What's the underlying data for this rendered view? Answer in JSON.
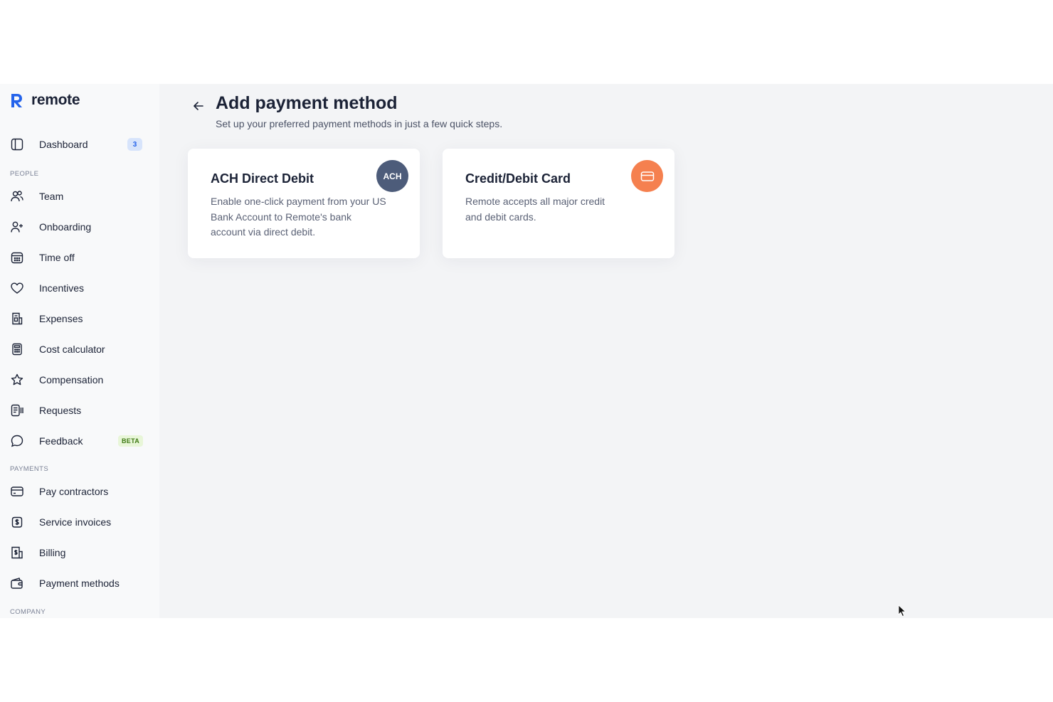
{
  "brand": {
    "name": "remote",
    "accent": "#2463eb"
  },
  "sidebar": {
    "dashboard": {
      "label": "Dashboard",
      "badge": "3",
      "icon": "sidebar-panel-icon"
    },
    "people_section": "PEOPLE",
    "people_items": [
      {
        "label": "Team",
        "icon": "team-icon"
      },
      {
        "label": "Onboarding",
        "icon": "user-plus-icon"
      },
      {
        "label": "Time off",
        "icon": "calendar-icon"
      },
      {
        "label": "Incentives",
        "icon": "heart-icon"
      },
      {
        "label": "Expenses",
        "icon": "receipt-icon"
      },
      {
        "label": "Cost calculator",
        "icon": "calculator-icon"
      },
      {
        "label": "Compensation",
        "icon": "star-icon"
      },
      {
        "label": "Requests",
        "icon": "requests-icon"
      },
      {
        "label": "Feedback",
        "icon": "chat-bubble-icon",
        "badge": "BETA"
      }
    ],
    "payments_section": "PAYMENTS",
    "payments_items": [
      {
        "label": "Pay contractors",
        "icon": "credit-card-icon"
      },
      {
        "label": "Service invoices",
        "icon": "invoice-dollar-icon"
      },
      {
        "label": "Billing",
        "icon": "billing-icon"
      },
      {
        "label": "Payment methods",
        "icon": "wallet-icon"
      }
    ],
    "company_section": "COMPANY"
  },
  "main": {
    "title": "Add payment method",
    "subtitle": "Set up your preferred payment methods in just a few quick steps.",
    "cards": [
      {
        "title": "ACH Direct Debit",
        "description": "Enable one-click payment from your US Bank Account to Remote's bank account via direct debit.",
        "badge_text": "ACH",
        "badge_color": "#4d5c7a"
      },
      {
        "title": "Credit/Debit Card",
        "description": "Remote accepts all major credit and debit cards.",
        "badge_icon": "credit-card-icon",
        "badge_color": "#f5804f"
      }
    ]
  }
}
